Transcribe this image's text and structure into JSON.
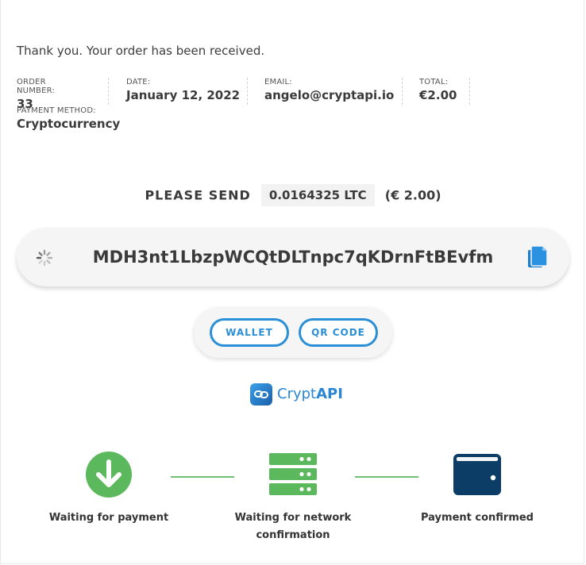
{
  "thank_you": "Thank you. Your order has been received.",
  "overview": {
    "order_number_label": "ORDER NUMBER:",
    "order_number": "33",
    "date_label": "DATE:",
    "date": "January 12, 2022",
    "email_label": "EMAIL:",
    "email": "angelo@cryptapi.io",
    "total_label": "TOTAL:",
    "total": "€2.00",
    "payment_method_label": "PAYMENT METHOD:",
    "payment_method": "Cryptocurrency"
  },
  "payment": {
    "please_send_label": "PLEASE SEND",
    "crypto_amount": "0.0164325 LTC",
    "fiat_amount": "(€ 2.00)",
    "address": "MDH3nt1LbzpWCQtDLTnpc7qKDrnFtBEvfm",
    "wallet_button": "WALLET",
    "qr_button": "QR CODE"
  },
  "brand": {
    "name_part1": "Crypt",
    "name_part2": "API"
  },
  "progress": {
    "steps": [
      {
        "label": "Waiting for payment",
        "icon": "arrow-down-circle-icon"
      },
      {
        "label": "Waiting for network confirmation",
        "icon": "server-icon"
      },
      {
        "label": "Payment confirmed",
        "icon": "wallet-icon"
      }
    ]
  },
  "colors": {
    "accent": "#2a8fd6",
    "success": "#5cb85c",
    "wallet": "#0b3d66"
  }
}
